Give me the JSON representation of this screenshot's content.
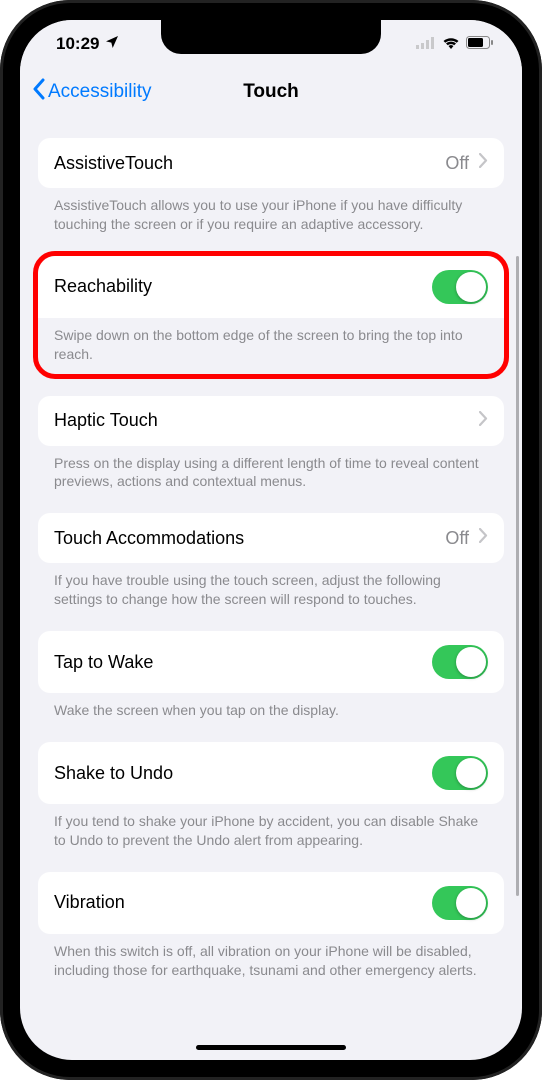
{
  "status": {
    "time": "10:29",
    "locationIcon": "location-arrow"
  },
  "nav": {
    "back": "Accessibility",
    "title": "Touch"
  },
  "rows": {
    "assistive": {
      "title": "AssistiveTouch",
      "value": "Off",
      "footer": "AssistiveTouch allows you to use your iPhone if you have difficulty touching the screen or if you require an adaptive accessory."
    },
    "reachability": {
      "title": "Reachability",
      "toggle": true,
      "footer": "Swipe down on the bottom edge of the screen to bring the top into reach."
    },
    "haptic": {
      "title": "Haptic Touch",
      "footer": "Press on the display using a different length of time to reveal content previews, actions and contextual menus."
    },
    "accommodations": {
      "title": "Touch Accommodations",
      "value": "Off",
      "footer": "If you have trouble using the touch screen, adjust the following settings to change how the screen will respond to touches."
    },
    "tapWake": {
      "title": "Tap to Wake",
      "toggle": true,
      "footer": "Wake the screen when you tap on the display."
    },
    "shake": {
      "title": "Shake to Undo",
      "toggle": true,
      "footer": "If you tend to shake your iPhone by accident, you can disable Shake to Undo to prevent the Undo alert from appearing."
    },
    "vibration": {
      "title": "Vibration",
      "toggle": true,
      "footer": "When this switch is off, all vibration on your iPhone will be disabled, including those for earthquake, tsunami and other emergency alerts."
    }
  }
}
